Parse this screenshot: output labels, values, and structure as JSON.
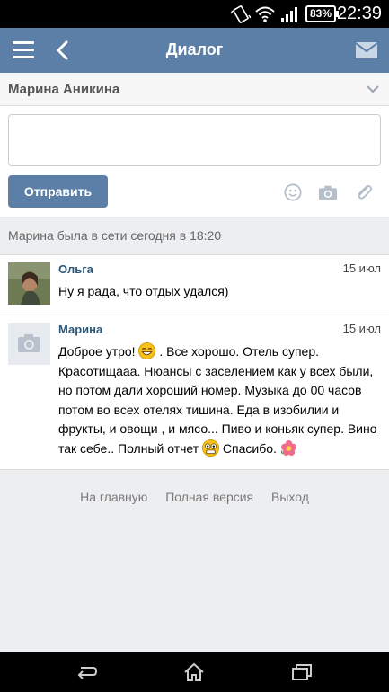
{
  "status_bar": {
    "time": "22:39",
    "battery": "83%",
    "icons": [
      "vibrate-icon",
      "wifi-icon",
      "signal-icon",
      "battery-icon"
    ]
  },
  "header": {
    "title": "Диалог",
    "menu_icon": "menu-icon",
    "back_icon": "back-arrow-icon",
    "mail_icon": "mail-icon",
    "background": "#5b7fa6"
  },
  "dialog": {
    "partner_name": "Марина Аникина"
  },
  "compose": {
    "message_value": "",
    "send_label": "Отправить",
    "tools": [
      "smile-icon",
      "camera-icon",
      "paperclip-icon"
    ]
  },
  "last_seen": "Марина была в сети сегодня в 18:20",
  "messages": [
    {
      "author": "Ольга",
      "date": "15 июл",
      "text": "Ну я рада, что отдых удался)"
    },
    {
      "author": "Марина",
      "date": "15 июл",
      "text_parts": [
        "Доброе утро! ",
        " . Все хорошо. Отель супер. Красотищааа. Нюансы с заселением как у всех были, но потом дали хороший номер. Музыка до 00 часов потом во всех отелях тишина. Еда в изобилии и фрукты, и овощи , и мясо... Пиво и коньяк супер. Вино так себе.. Полный отчет ",
        " Спасибо. "
      ],
      "emojis": [
        "grin-emoji",
        "surprised-emoji",
        "flower-emoji"
      ]
    }
  ],
  "footer": {
    "links": [
      "На главную",
      "Полная версия",
      "Выход"
    ]
  },
  "nav_bar": [
    "back-nav-icon",
    "home-nav-icon",
    "recent-apps-icon"
  ]
}
